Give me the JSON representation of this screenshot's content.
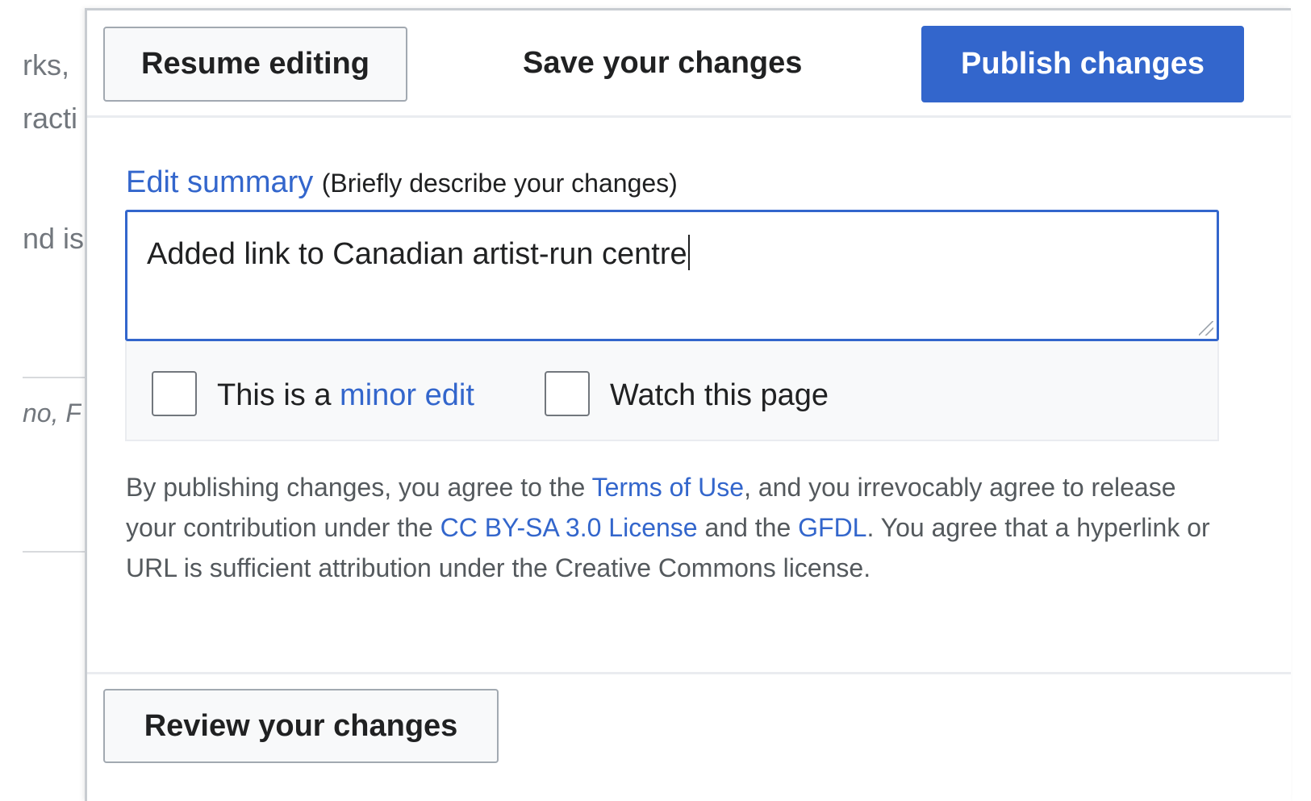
{
  "background": {
    "fragments": [
      "rks,",
      "racti",
      "nd is",
      "no, F"
    ]
  },
  "dialog": {
    "title": "Save your changes",
    "resume_label": "Resume editing",
    "publish_label": "Publish changes",
    "summary": {
      "label": "Edit summary",
      "hint": "(Briefly describe your changes)",
      "value": "Added link to Canadian artist-run centre"
    },
    "options": {
      "minor_prefix": "This is a ",
      "minor_link": "minor edit",
      "minor_checked": false,
      "watch_label": "Watch this page",
      "watch_checked": false
    },
    "legal": {
      "part1": "By publishing changes, you agree to the ",
      "terms_link": "Terms of Use",
      "part2": ", and you irrevocably agree to release your contribution under the ",
      "license_link": "CC BY-SA 3.0 License",
      "part3": " and the ",
      "gfdl_link": "GFDL",
      "part4": ". You agree that a hyperlink or URL is sufficient attribution under the Creative Commons license."
    },
    "review_label": "Review your changes"
  },
  "colors": {
    "accent": "#3366cc",
    "border": "#a2a9b1"
  }
}
